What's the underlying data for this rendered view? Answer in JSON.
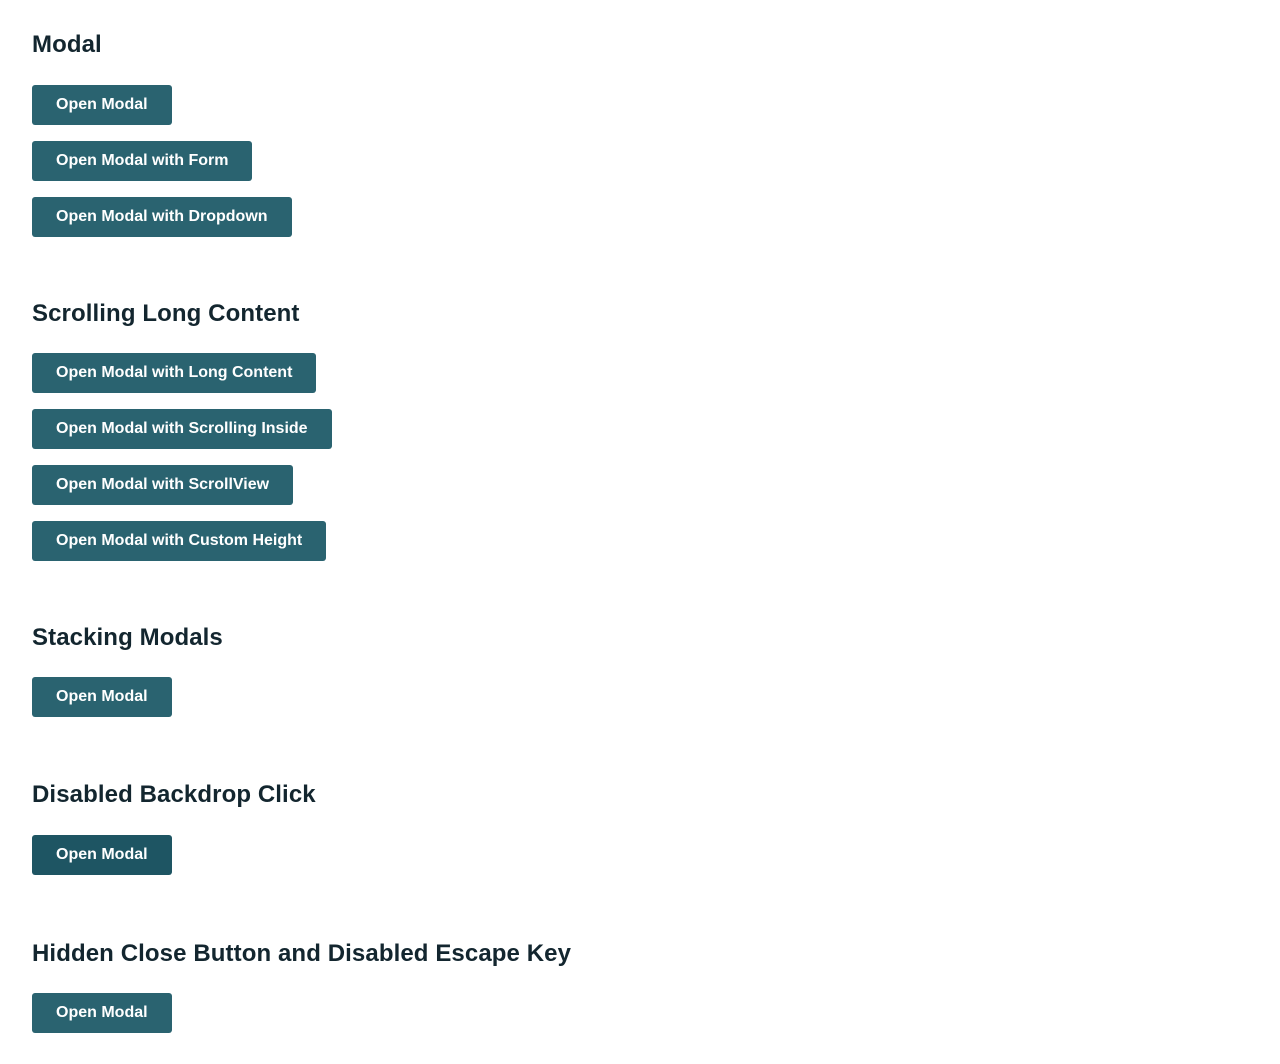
{
  "sections": [
    {
      "title": "Modal",
      "buttons": [
        "Open Modal",
        "Open Modal with Form",
        "Open Modal with Dropdown"
      ]
    },
    {
      "title": "Scrolling Long Content",
      "buttons": [
        "Open Modal with Long Content",
        "Open Modal with Scrolling Inside",
        "Open Modal with ScrollView",
        "Open Modal with Custom Height"
      ]
    },
    {
      "title": "Stacking Modals",
      "buttons": [
        "Open Modal"
      ]
    },
    {
      "title": "Disabled Backdrop Click",
      "buttons": [
        "Open Modal"
      ]
    },
    {
      "title": "Hidden Close Button and Disabled Escape Key",
      "buttons": [
        "Open Modal"
      ]
    }
  ],
  "colors": {
    "button_bg": "#2a6370",
    "button_bg_focused": "#1e5563",
    "button_text": "#ffffff",
    "heading_text": "#13262f",
    "page_bg": "#ffffff"
  }
}
